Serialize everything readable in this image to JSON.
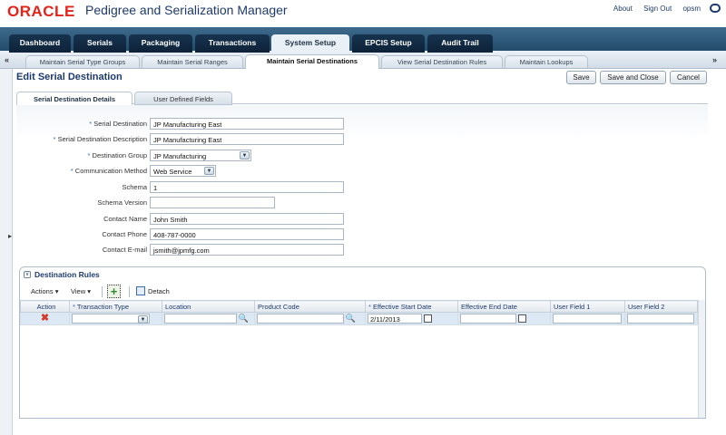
{
  "header": {
    "brand": "ORACLE",
    "app_title": "Pedigree and Serialization Manager",
    "links": [
      "About",
      "Sign Out",
      "opsm"
    ]
  },
  "main_tabs": [
    {
      "label": "Dashboard",
      "active": false
    },
    {
      "label": "Serials",
      "active": false
    },
    {
      "label": "Packaging",
      "active": false
    },
    {
      "label": "Transactions",
      "active": false
    },
    {
      "label": "System Setup",
      "active": true
    },
    {
      "label": "EPCIS Setup",
      "active": false
    },
    {
      "label": "Audit Trail",
      "active": false
    }
  ],
  "sub_tabs": [
    {
      "label": "Maintain Serial Type Groups",
      "active": false
    },
    {
      "label": "Maintain Serial Ranges",
      "active": false
    },
    {
      "label": "Maintain Serial Destinations",
      "active": true
    },
    {
      "label": "View Serial Destination Rules",
      "active": false
    },
    {
      "label": "Maintain Lookups",
      "active": false
    }
  ],
  "page": {
    "title": "Edit Serial Destination",
    "buttons": {
      "save": "Save",
      "save_close": "Save and Close",
      "cancel": "Cancel"
    }
  },
  "detail_tabs": [
    {
      "label": "Serial Destination Details",
      "active": true
    },
    {
      "label": "User Defined Fields",
      "active": false
    }
  ],
  "form": {
    "serial_destination": {
      "label": "Serial Destination",
      "required": true,
      "value": "JP Manufacturing East"
    },
    "description": {
      "label": "Serial Destination Description",
      "required": true,
      "value": "JP Manufacturing East"
    },
    "destination_group": {
      "label": "Destination Group",
      "required": true,
      "value": "JP Manufacturing"
    },
    "communication_method": {
      "label": "Communication Method",
      "required": true,
      "value": "Web Service"
    },
    "schema": {
      "label": "Schema",
      "required": false,
      "value": "1"
    },
    "schema_version": {
      "label": "Schema Version",
      "required": false,
      "value": ""
    },
    "contact_name": {
      "label": "Contact Name",
      "required": false,
      "value": "John Smith"
    },
    "contact_phone": {
      "label": "Contact Phone",
      "required": false,
      "value": "408-787-0000"
    },
    "contact_email": {
      "label": "Contact E-mail",
      "required": false,
      "value": "jsmith@jpmfg.com"
    }
  },
  "rules": {
    "title": "Destination Rules",
    "toolbar": {
      "actions": "Actions",
      "view": "View",
      "detach": "Detach"
    },
    "columns": [
      {
        "label": "Action",
        "required": false
      },
      {
        "label": "Transaction Type",
        "required": true
      },
      {
        "label": "Location",
        "required": false
      },
      {
        "label": "Product Code",
        "required": false
      },
      {
        "label": "Effective Start Date",
        "required": true
      },
      {
        "label": "Effective End Date",
        "required": false
      },
      {
        "label": "User Field 1",
        "required": false
      },
      {
        "label": "User Field 2",
        "required": false
      }
    ],
    "row": {
      "transaction_type": "",
      "location": "",
      "product_code": "",
      "start_date": "2/11/2013",
      "end_date": "",
      "user_field_1": "",
      "user_field_2": ""
    }
  },
  "colors": {
    "brand_red": "#e2231a",
    "nav_blue": "#244c6b",
    "title_blue": "#1d3a6b"
  }
}
